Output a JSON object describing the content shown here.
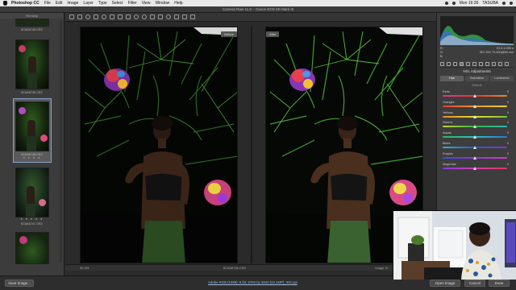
{
  "menubar": {
    "app": "Photoshop CC",
    "items": [
      "File",
      "Edit",
      "Image",
      "Layer",
      "Type",
      "Select",
      "Filter",
      "View",
      "Window",
      "Help"
    ],
    "clock": "Mon 16:36",
    "user": "TASUBA"
  },
  "window": {
    "title": "Camera Raw 11.0  –  Canon EOS 5D Mark III"
  },
  "filmstrip": {
    "header": "Filmstrip",
    "thumbs": [
      {
        "label": "6C6A6745.CR2",
        "stars": ""
      },
      {
        "label": "6C6A6745.CR2",
        "stars": ""
      },
      {
        "label": "6C6A6746.CR2",
        "stars": "★ ★ ★ ★"
      },
      {
        "label": "6C6A6747.CR2",
        "stars": "★ ★ ★ ★ ★"
      },
      {
        "label": "",
        "stars": ""
      }
    ]
  },
  "view": {
    "before_label": "Before",
    "after_label": "After",
    "zoom": "30.4%",
    "filename": "6C6A6746.CR2",
    "image_count": "Image 3/"
  },
  "panel": {
    "readout": [
      {
        "left": "R:",
        "mid": "",
        "right": "f/2.8   1/250 s"
      },
      {
        "left": "G:",
        "mid": "",
        "right": "ISO 200   70-200@88 mm"
      },
      {
        "left": "B:",
        "mid": "",
        "right": ""
      }
    ],
    "title": "HSL Adjustments",
    "tabs": [
      "Hue",
      "Saturation",
      "Luminance"
    ],
    "active_tab": "Hue",
    "default_label": "Default",
    "sliders": [
      {
        "name": "Reds",
        "value": "0",
        "color": "linear-gradient(90deg,#d43b8f,#e33,#e68a2a)"
      },
      {
        "name": "Oranges",
        "value": "0",
        "color": "linear-gradient(90deg,#e23b3b,#f09a2a,#e6d02a)"
      },
      {
        "name": "Yellows",
        "value": "0",
        "color": "linear-gradient(90deg,#e8882a,#e9dc2a,#7ac43a)"
      },
      {
        "name": "Greens",
        "value": "0",
        "color": "linear-gradient(90deg,#c5d22a,#33b845,#2ab8b0)"
      },
      {
        "name": "Aquas",
        "value": "0",
        "color": "linear-gradient(90deg,#32b84a,#2ac0c8,#2a78d6)"
      },
      {
        "name": "Blues",
        "value": "0",
        "color": "linear-gradient(90deg,#2ab8c4,#2a5ad6,#7a3ad2)"
      },
      {
        "name": "Purples",
        "value": "0",
        "color": "linear-gradient(90deg,#3a4ad6,#8a3ad6,#d23ac4)"
      },
      {
        "name": "Magentas",
        "value": "0",
        "color": "linear-gradient(90deg,#8a3ad6,#d63ab4,#e23a5a)"
      }
    ]
  },
  "bottom": {
    "save_label": "Save Image...",
    "workflow": "Adobe RGB (1998); 8 bit; 5760 by 3840 (22.1MP); 300 ppi",
    "open_label": "Open Image",
    "cancel_label": "Cancel",
    "done_label": "Done"
  }
}
